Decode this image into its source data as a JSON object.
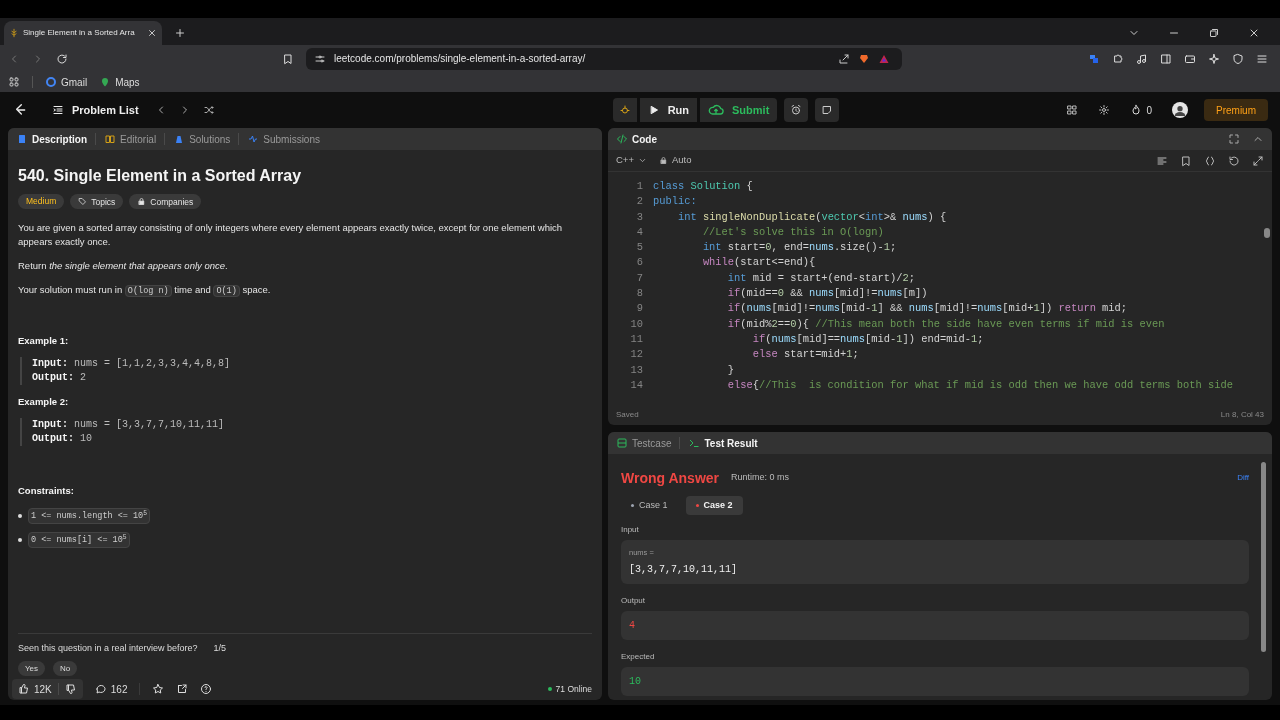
{
  "browser": {
    "tab_title": "Single Element in a Sorted Arra",
    "url": "leetcode.com/problems/single-element-in-a-sorted-array/",
    "bookmarks": [
      "Gmail",
      "Maps"
    ]
  },
  "nav": {
    "problem_list": "Problem List",
    "run": "Run",
    "submit": "Submit",
    "streak": "0",
    "premium": "Premium"
  },
  "description_tabs": [
    {
      "label": "Description",
      "selected": true
    },
    {
      "label": "Editorial",
      "selected": false
    },
    {
      "label": "Solutions",
      "selected": false
    },
    {
      "label": "Submissions",
      "selected": false
    }
  ],
  "problem": {
    "title": "540. Single Element in a Sorted Array",
    "difficulty": "Medium",
    "tags": [
      "Topics",
      "Companies"
    ],
    "paragraphs": [
      [
        {
          "kind": "text",
          "text": "You are given a sorted array consisting of only integers where every element appears exactly twice, except for one element which appears exactly once."
        }
      ],
      [
        {
          "kind": "text",
          "text": "Return *the single element that appears only once*."
        }
      ],
      [
        {
          "kind": "text",
          "text": "Your solution must run in "
        },
        {
          "kind": "code",
          "text": "O(log n)"
        },
        {
          "kind": "text",
          "text": " time and "
        },
        {
          "kind": "code",
          "text": "O(1)"
        },
        {
          "kind": "text",
          "text": " space."
        }
      ]
    ],
    "examples": [
      {
        "title": "Example 1:",
        "lines": [
          "**Input:** nums = [1,1,2,3,3,4,4,8,8]",
          "**Output:** 2"
        ]
      },
      {
        "title": "Example 2:",
        "lines": [
          "**Input:** nums = [3,3,7,7,10,11,11]",
          "**Output:** 10"
        ]
      }
    ],
    "constraints_title": "Constraints:",
    "constraints": [
      "1 <= nums.length <= 10$^{5}$",
      "0 <= nums[i] <= 10$^{5}$"
    ],
    "interview_question": "Seen this question in a real interview before?",
    "interview_page": "1/5",
    "answers": [
      "Yes",
      "No"
    ],
    "likes": "12K",
    "comments": "162",
    "online": "71 Online"
  },
  "code": {
    "title": "Code",
    "language": "C++",
    "mode": "Auto",
    "status": "Saved",
    "position": "Ln 8, Col 43",
    "lines": [
      {
        "number": "1",
        "tokens": [
          {
            "kind": "kw",
            "text": "class"
          },
          {
            "kind": "type",
            "text": " Solution"
          },
          {
            "kind": "p",
            "text": " {"
          }
        ]
      },
      {
        "number": "2",
        "tokens": [
          {
            "kind": "kw",
            "text": "public:"
          }
        ]
      },
      {
        "number": "3",
        "tokens": [
          {
            "kind": "kw",
            "text": "    int"
          },
          {
            "kind": "fn",
            "text": " singleNonDuplicate"
          },
          {
            "kind": "p",
            "text": "("
          },
          {
            "kind": "type",
            "text": "vector"
          },
          {
            "kind": "p",
            "text": "<"
          },
          {
            "kind": "kw",
            "text": "int"
          },
          {
            "kind": "p",
            "text": ">& "
          },
          {
            "kind": "var",
            "text": "nums"
          },
          {
            "kind": "p",
            "text": ") {"
          }
        ]
      },
      {
        "number": "4",
        "tokens": [
          {
            "kind": "cm",
            "text": "        //Let's solve this in O(logn)"
          }
        ]
      },
      {
        "number": "5",
        "tokens": [
          {
            "kind": "kw",
            "text": "        int"
          },
          {
            "kind": "p",
            "text": " start="
          },
          {
            "kind": "num",
            "text": "0"
          },
          {
            "kind": "p",
            "text": ", end="
          },
          {
            "kind": "var",
            "text": "nums"
          },
          {
            "kind": "p",
            "text": ".size()-"
          },
          {
            "kind": "num",
            "text": "1"
          },
          {
            "kind": "p",
            "text": ";"
          }
        ]
      },
      {
        "number": "6",
        "tokens": [
          {
            "kind": "ctrl",
            "text": "        while"
          },
          {
            "kind": "p",
            "text": "(start<=end){"
          }
        ]
      },
      {
        "number": "7",
        "tokens": [
          {
            "kind": "kw",
            "text": "            int"
          },
          {
            "kind": "p",
            "text": " mid = start+(end-start)/"
          },
          {
            "kind": "num",
            "text": "2"
          },
          {
            "kind": "p",
            "text": ";"
          }
        ]
      },
      {
        "number": "8",
        "tokens": [
          {
            "kind": "ctrl",
            "text": "            if"
          },
          {
            "kind": "p",
            "text": "(mid=="
          },
          {
            "kind": "num",
            "text": "0"
          },
          {
            "kind": "p",
            "text": " && "
          },
          {
            "kind": "var",
            "text": "nums"
          },
          {
            "kind": "p",
            "text": "[mid]!="
          },
          {
            "kind": "var",
            "text": "nums"
          },
          {
            "kind": "p",
            "text": "[m])"
          }
        ]
      },
      {
        "number": "9",
        "tokens": [
          {
            "kind": "ctrl",
            "text": "            if"
          },
          {
            "kind": "p",
            "text": "("
          },
          {
            "kind": "var",
            "text": "nums"
          },
          {
            "kind": "p",
            "text": "[mid]!="
          },
          {
            "kind": "var",
            "text": "nums"
          },
          {
            "kind": "p",
            "text": "[mid-"
          },
          {
            "kind": "num",
            "text": "1"
          },
          {
            "kind": "p",
            "text": "] && "
          },
          {
            "kind": "var",
            "text": "nums"
          },
          {
            "kind": "p",
            "text": "[mid]!="
          },
          {
            "kind": "var",
            "text": "nums"
          },
          {
            "kind": "p",
            "text": "[mid+"
          },
          {
            "kind": "num",
            "text": "1"
          },
          {
            "kind": "p",
            "text": "]) "
          },
          {
            "kind": "ctrl",
            "text": "return"
          },
          {
            "kind": "p",
            "text": " mid;"
          }
        ]
      },
      {
        "number": "10",
        "tokens": [
          {
            "kind": "ctrl",
            "text": "            if"
          },
          {
            "kind": "p",
            "text": "(mid%"
          },
          {
            "kind": "num",
            "text": "2"
          },
          {
            "kind": "p",
            "text": "=="
          },
          {
            "kind": "num",
            "text": "0"
          },
          {
            "kind": "p",
            "text": "){ "
          },
          {
            "kind": "cm",
            "text": "//This mean both the side have even terms if mid is even"
          }
        ]
      },
      {
        "number": "11",
        "tokens": [
          {
            "kind": "ctrl",
            "text": "                if"
          },
          {
            "kind": "p",
            "text": "("
          },
          {
            "kind": "var",
            "text": "nums"
          },
          {
            "kind": "p",
            "text": "[mid]=="
          },
          {
            "kind": "var",
            "text": "nums"
          },
          {
            "kind": "p",
            "text": "[mid-"
          },
          {
            "kind": "num",
            "text": "1"
          },
          {
            "kind": "p",
            "text": "]) end=mid-"
          },
          {
            "kind": "num",
            "text": "1"
          },
          {
            "kind": "p",
            "text": ";"
          }
        ]
      },
      {
        "number": "12",
        "tokens": [
          {
            "kind": "ctrl",
            "text": "                else"
          },
          {
            "kind": "p",
            "text": " start=mid+"
          },
          {
            "kind": "num",
            "text": "1"
          },
          {
            "kind": "p",
            "text": ";"
          }
        ]
      },
      {
        "number": "13",
        "tokens": [
          {
            "kind": "p",
            "text": "            }"
          }
        ]
      },
      {
        "number": "14",
        "tokens": [
          {
            "kind": "ctrl",
            "text": "            else"
          },
          {
            "kind": "p",
            "text": "{"
          },
          {
            "kind": "cm",
            "text": "//This  is condition for what if mid is odd then we have odd terms both side"
          }
        ]
      }
    ]
  },
  "result_tabs": [
    {
      "label": "Testcase",
      "selected": false
    },
    {
      "label": "Test Result",
      "selected": true
    }
  ],
  "result": {
    "verdict": "Wrong Answer",
    "runtime": "Runtime: 0 ms",
    "diff": "Diff",
    "cases": [
      {
        "label": "Case 1",
        "selected": false,
        "color": "#9ca3af"
      },
      {
        "label": "Case 2",
        "selected": true,
        "color": "#ef4743"
      }
    ],
    "input_label": "Input",
    "input_name": "nums =",
    "input_value": "[3,3,7,7,10,11,11]",
    "outputs": [
      {
        "label": "Output",
        "value": "4",
        "kind": "wrong"
      },
      {
        "label": "Expected",
        "value": "10",
        "kind": "correct"
      }
    ]
  }
}
